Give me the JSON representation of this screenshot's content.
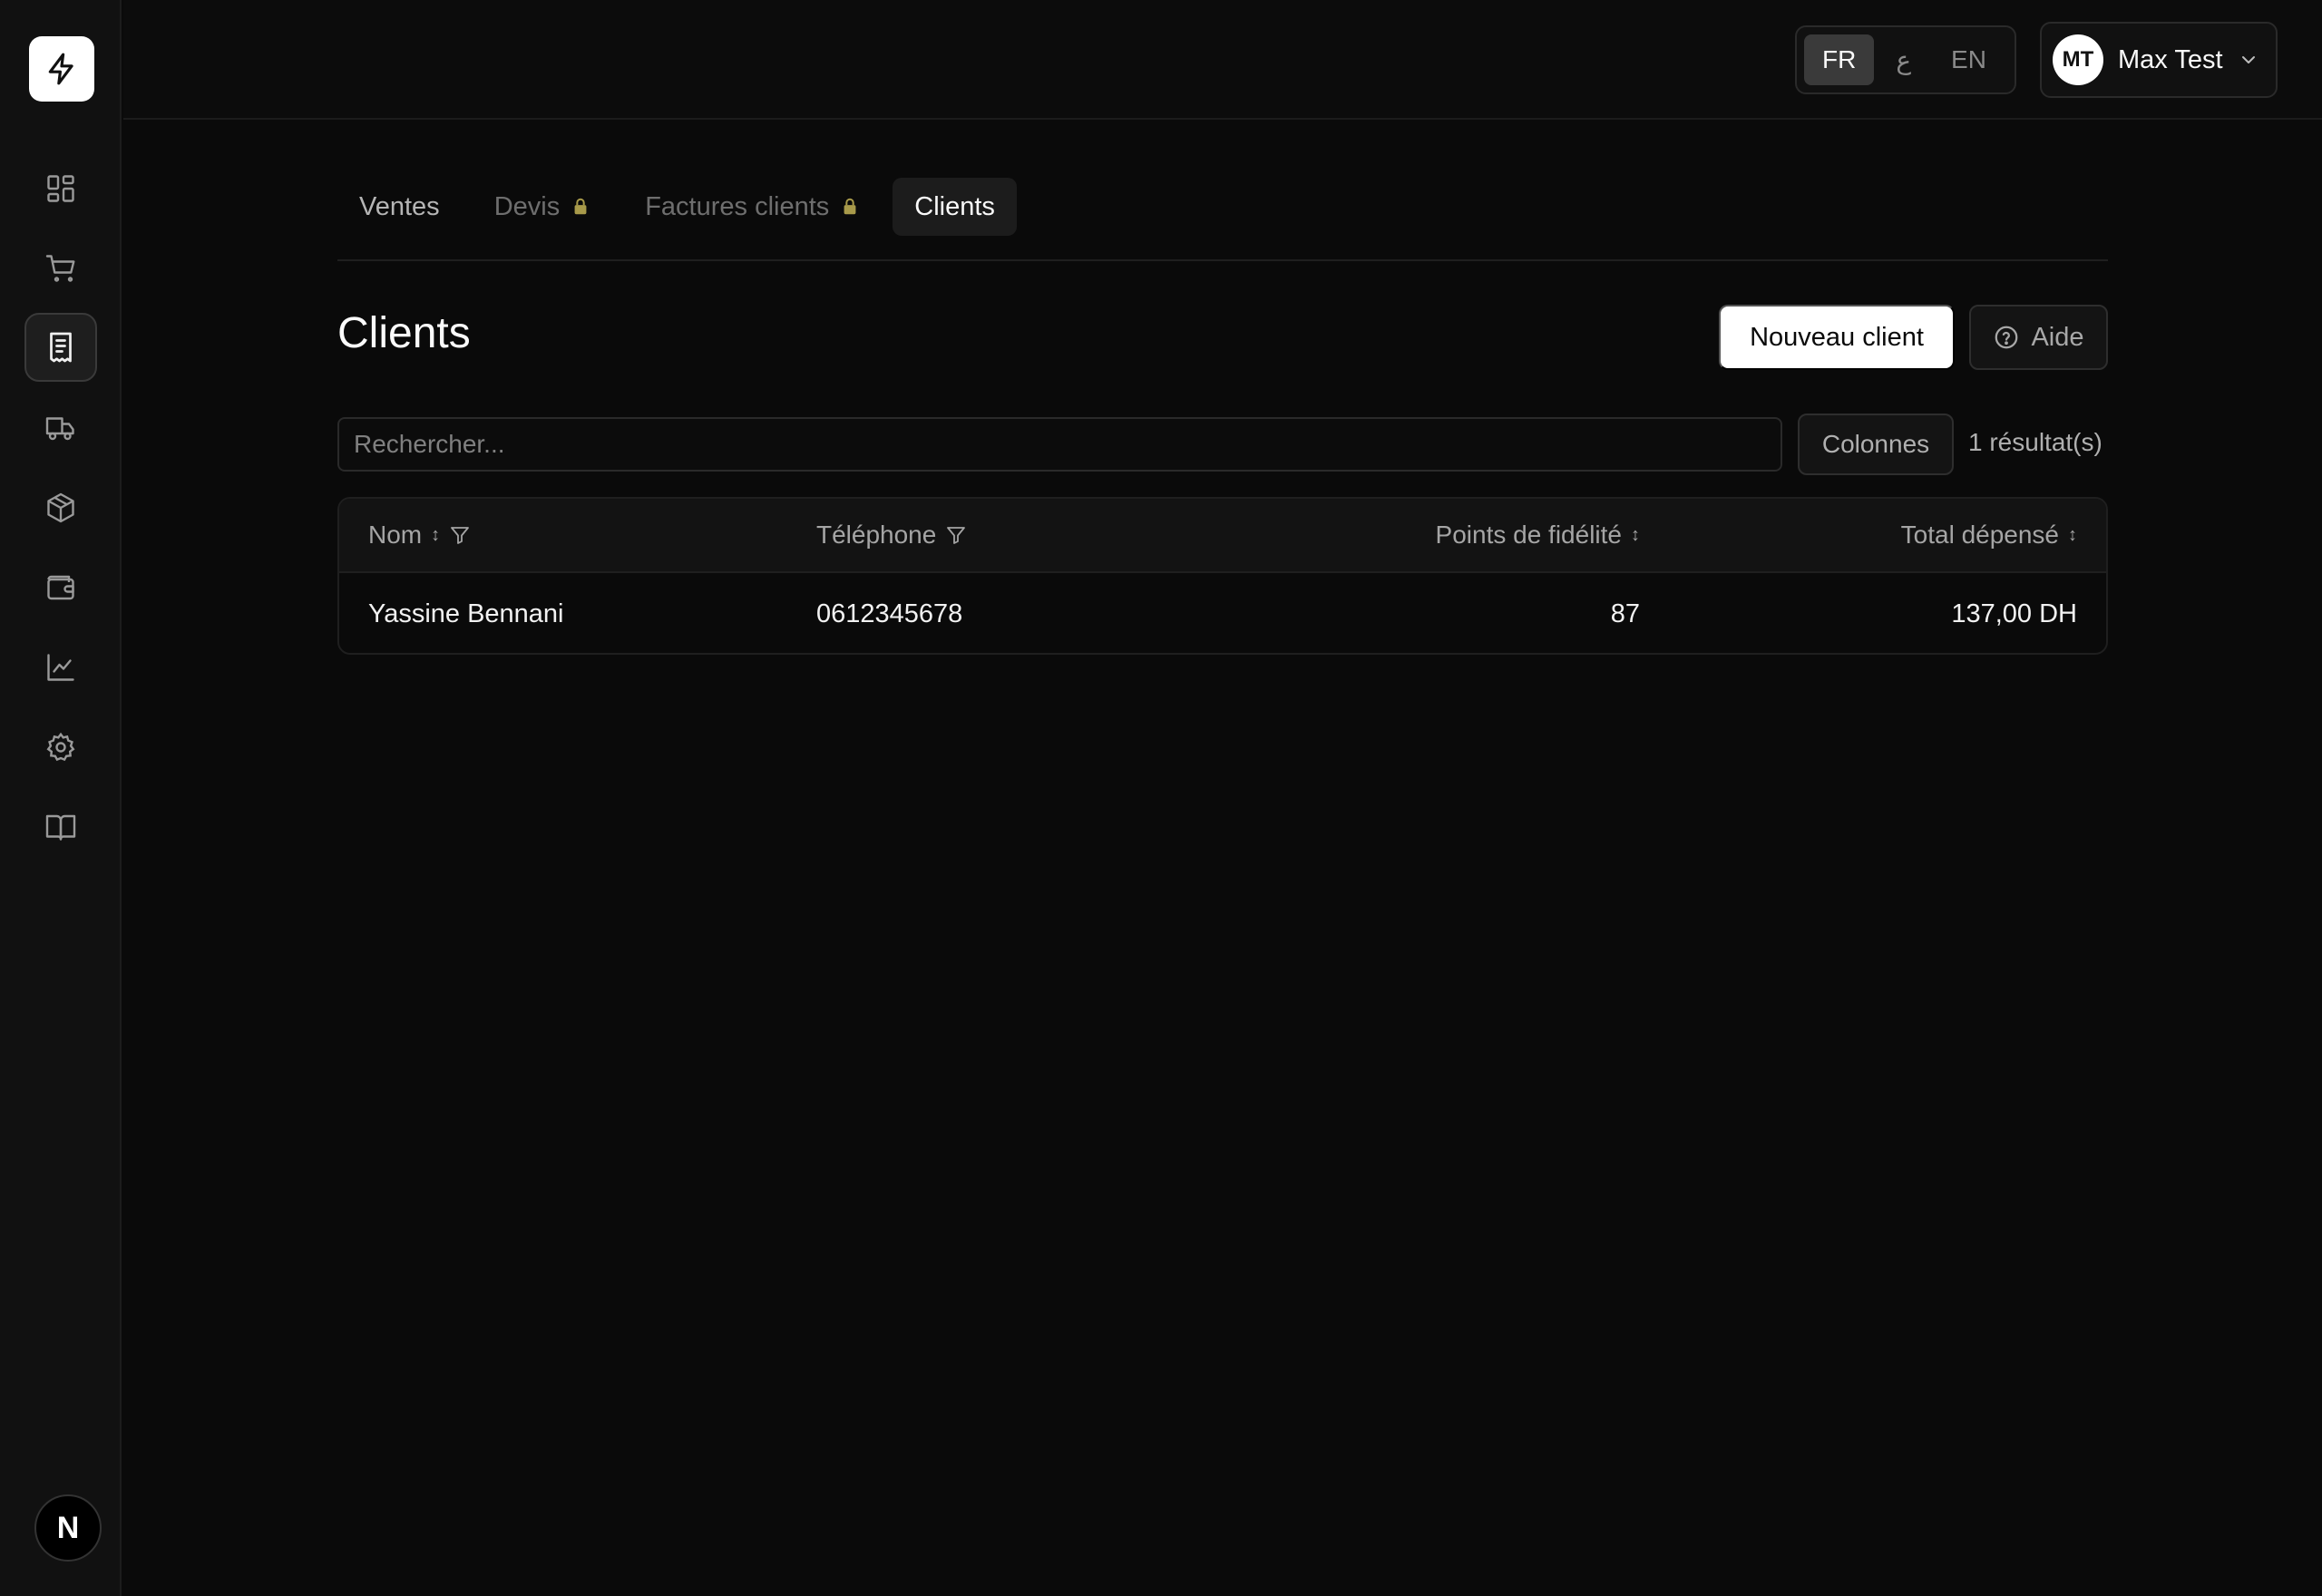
{
  "colors": {
    "background": "#0a0a0a",
    "sidebar": "#111111",
    "primary_button": "#ffffff",
    "lock": "#a89a4a"
  },
  "sidebar": {
    "logo_icon": "bolt-icon",
    "items": [
      {
        "icon": "dashboard-icon"
      },
      {
        "icon": "cart-icon"
      },
      {
        "icon": "receipt-icon",
        "active": true
      },
      {
        "icon": "truck-icon"
      },
      {
        "icon": "package-icon"
      },
      {
        "icon": "wallet-icon"
      },
      {
        "icon": "chart-line-icon"
      },
      {
        "icon": "gear-icon"
      },
      {
        "icon": "book-icon"
      }
    ],
    "badge": "N"
  },
  "topbar": {
    "languages": [
      "FR",
      "ع",
      "EN"
    ],
    "active_language": "FR",
    "user": {
      "initials": "MT",
      "name": "Max Test"
    }
  },
  "tabs": [
    {
      "label": "Ventes",
      "locked": false,
      "active": false
    },
    {
      "label": "Devis",
      "locked": true,
      "active": false
    },
    {
      "label": "Factures clients",
      "locked": true,
      "active": false
    },
    {
      "label": "Clients",
      "locked": false,
      "active": true
    }
  ],
  "header": {
    "title": "Clients",
    "new_button": "Nouveau client",
    "help_button": "Aide"
  },
  "toolbar": {
    "search_placeholder": "Rechercher...",
    "columns_button": "Colonnes",
    "result_count": "1 résultat(s)"
  },
  "table": {
    "columns": [
      "Nom",
      "Téléphone",
      "Points de fidélité",
      "Total dépensé"
    ],
    "rows": [
      {
        "name": "Yassine Bennani",
        "phone": "0612345678",
        "points": "87",
        "total": "137,00 DH"
      }
    ]
  }
}
